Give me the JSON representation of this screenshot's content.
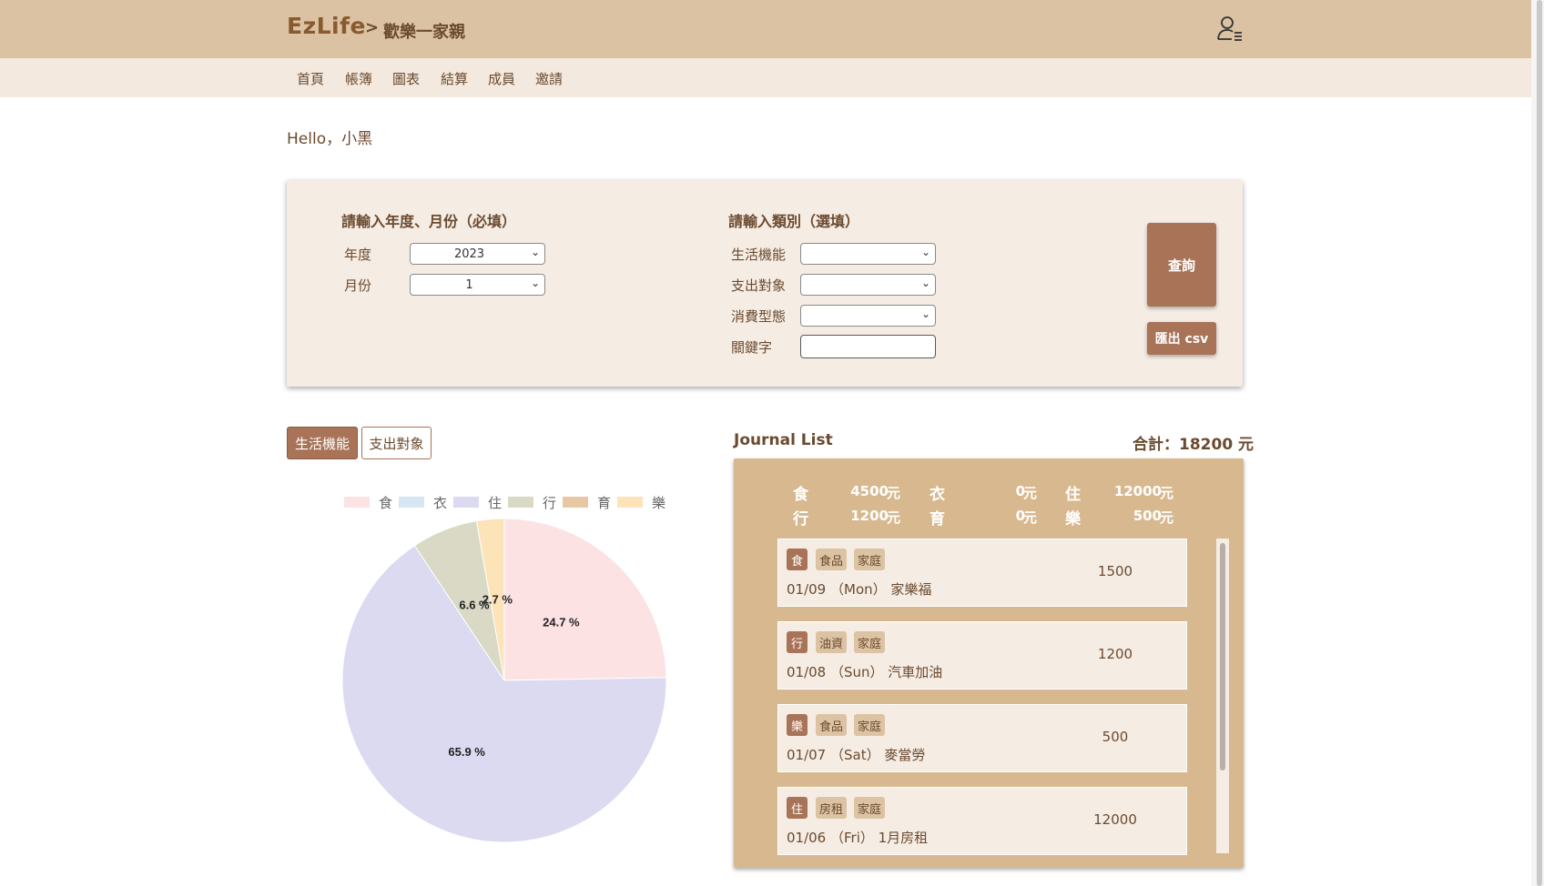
{
  "header": {
    "brand": "EzLife",
    "separator": ">",
    "ledger_name": "歡樂一家親",
    "user_icon": "user-menu-icon"
  },
  "nav": [
    "首頁",
    "帳簿",
    "圖表",
    "結算",
    "成員",
    "邀請"
  ],
  "greeting": "Hello，小黑",
  "filter": {
    "date_section_title": "請輸入年度、月份（必填）",
    "year_label": "年度",
    "year_value": "2023",
    "month_label": "月份",
    "month_value": "1",
    "category_section_title": "請輸入類別（選填）",
    "life_function_label": "生活機能",
    "life_function_value": "",
    "expense_target_label": "支出對象",
    "expense_target_value": "",
    "consumption_type_label": "消費型態",
    "consumption_type_value": "",
    "keyword_label": "關鍵字",
    "keyword_value": "",
    "query_button": "查詢",
    "export_button": "匯出 csv"
  },
  "chart_tabs": [
    "生活機能",
    "支出對象"
  ],
  "chart_data": {
    "type": "pie",
    "categories": [
      "食",
      "衣",
      "住",
      "行",
      "育",
      "樂"
    ],
    "values": [
      4500,
      0,
      12000,
      1200,
      0,
      500
    ],
    "colors": [
      "#fde2e4",
      "#d6e6f2",
      "#dbdaf0",
      "#d9d9c6",
      "#e8c7a3",
      "#fde3b8"
    ],
    "slice_labels": [
      "24.7 %",
      "",
      "65.9 %",
      "6.6 %",
      "",
      "2.7 %"
    ],
    "legend_position": "top"
  },
  "journal": {
    "title": "Journal List",
    "total_label": "合計：18200 元",
    "summary": [
      {
        "cat": "食",
        "amount": "4500",
        "unit": "元"
      },
      {
        "cat": "衣",
        "amount": "0",
        "unit": "元"
      },
      {
        "cat": "住",
        "amount": "12000",
        "unit": "元"
      },
      {
        "cat": "行",
        "amount": "1200",
        "unit": "元"
      },
      {
        "cat": "育",
        "amount": "0",
        "unit": "元"
      },
      {
        "cat": "樂",
        "amount": "500",
        "unit": "元"
      }
    ],
    "entries": [
      {
        "cat": "食",
        "type": "食品",
        "target": "家庭",
        "date": "01/09 （Mon） 家樂福",
        "amount": "1500"
      },
      {
        "cat": "行",
        "type": "油資",
        "target": "家庭",
        "date": "01/08 （Sun） 汽車加油",
        "amount": "1200"
      },
      {
        "cat": "樂",
        "type": "食品",
        "target": "家庭",
        "date": "01/07 （Sat） 麥當勞",
        "amount": "500"
      },
      {
        "cat": "住",
        "type": "房租",
        "target": "家庭",
        "date": "01/06 （Fri） 1月房租",
        "amount": "12000"
      }
    ]
  }
}
